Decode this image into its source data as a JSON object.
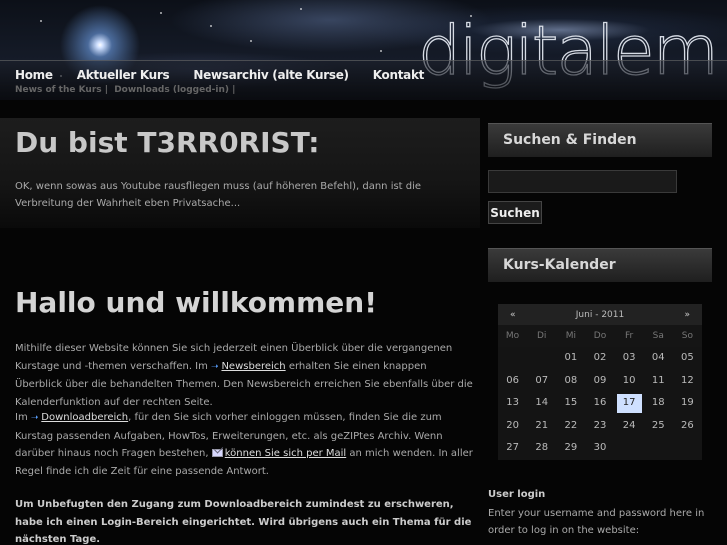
{
  "logo": "digitalem",
  "nav": {
    "items": [
      "Home",
      "Aktueller Kurs",
      "Newsarchiv (alte Kurse)",
      "Kontakt"
    ],
    "sub": [
      "News of the Kurs |",
      "Downloads (logged-in) |"
    ]
  },
  "post1": {
    "title": "Du bist T3RR0RIST:",
    "text": "OK, wenn sowas aus Youtube rausfliegen muss (auf höheren Befehl), dann ist die Verbreitung der Wahrheit eben Privatsache..."
  },
  "post2": {
    "title": "Hallo und willkommen!",
    "p1_a": "Mithilfe dieser Website können Sie sich jederzeit einen Überblick über die vergangenen Kurstage und -themen verschaffen. Im ",
    "p1_link": "Newsbereich",
    "p1_b": " erhalten Sie einen knappen Überblick über die behandelten Themen. Den Newsbereich erreichen Sie ebenfalls über die Kalenderfunktion auf der rechten Seite.",
    "p2_a": "Im ",
    "p2_link": "Downloadbereich",
    "p2_b": ", für den Sie sich vorher einloggen müssen, finden Sie die zum Kurstag passenden Aufgaben, HowTos, Erweiterungen, etc. als geZIPtes Archiv. Wenn darüber hinaus noch Fragen bestehen, ",
    "p2_mail": "können Sie sich per Mail",
    "p2_c": " an mich wenden. In aller Regel finde ich die Zeit für eine passende Antwort.",
    "p3": "Um Unbefugten den Zugang zum Downloadbereich zumindest zu erschweren, habe ich einen Login-Bereich eingerichtet. Wird übrigens auch ein Thema für die nächsten Tage."
  },
  "sidebar": {
    "search_title": "Suchen & Finden",
    "search_button": "Suchen",
    "calendar_title": "Kurs-Kalender",
    "calendar": {
      "prev": "«",
      "next": "»",
      "month": "Juni - 2011",
      "weekdays": [
        "Mo",
        "Di",
        "Mi",
        "Do",
        "Fr",
        "Sa",
        "So"
      ],
      "weeks": [
        [
          "",
          "",
          "01",
          "02",
          "03",
          "04",
          "05"
        ],
        [
          "06",
          "07",
          "08",
          "09",
          "10",
          "11",
          "12"
        ],
        [
          "13",
          "14",
          "15",
          "16",
          "17",
          "18",
          "19"
        ],
        [
          "20",
          "21",
          "22",
          "23",
          "24",
          "25",
          "26"
        ],
        [
          "27",
          "28",
          "29",
          "30",
          "",
          "",
          ""
        ]
      ],
      "today": "17"
    },
    "login_title": "User login",
    "login_text": "Enter your username and password here in order to log in on the website:"
  },
  "colors": {
    "today_bg": "#cfe0ff",
    "link_arrow": "#5aa0ff"
  }
}
